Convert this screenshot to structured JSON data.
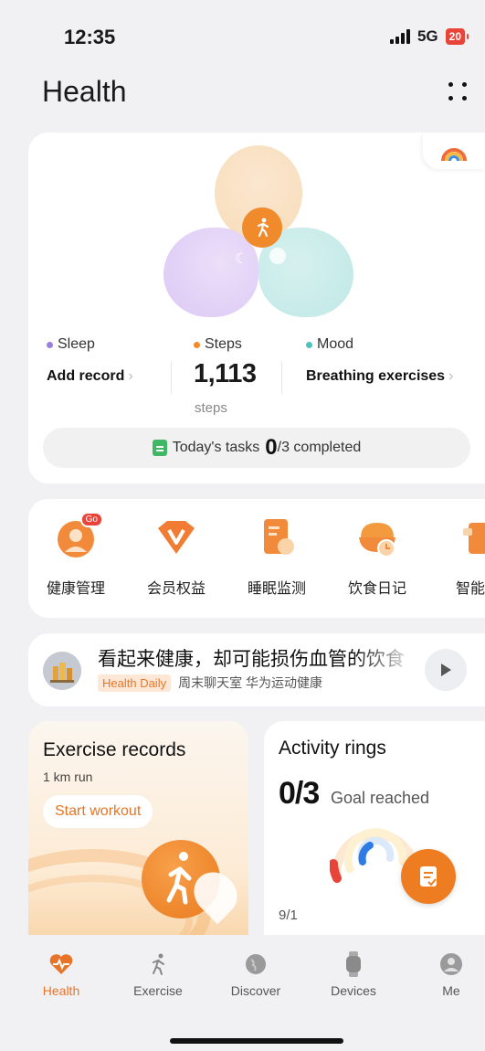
{
  "status_bar": {
    "time": "12:35",
    "network": "5G",
    "battery": "20"
  },
  "header": {
    "title": "Health"
  },
  "summary": {
    "sleep": {
      "label": "Sleep",
      "action": "Add record",
      "color": "#9b7de0"
    },
    "steps": {
      "label": "Steps",
      "value": "1,113",
      "unit": "steps",
      "color": "#f08a2a"
    },
    "mood": {
      "label": "Mood",
      "action": "Breathing exercises",
      "color": "#4cc4bd"
    },
    "tasks": {
      "prefix": "Today's tasks",
      "done": "0",
      "suffix": "/3 completed"
    }
  },
  "services": [
    {
      "label": "健康管理",
      "icon": "health-management-icon",
      "badge": "Go"
    },
    {
      "label": "会员权益",
      "icon": "membership-icon"
    },
    {
      "label": "睡眠监测",
      "icon": "sleep-monitor-icon"
    },
    {
      "label": "饮食日记",
      "icon": "diet-diary-icon"
    },
    {
      "label": "智能冰",
      "icon": "smart-device-icon"
    }
  ],
  "article": {
    "title": "看起来健康，却可能损伤血管的饮食",
    "tag": "Health Daily",
    "source": "周末聊天室 华为运动健康"
  },
  "exercise": {
    "title": "Exercise records",
    "subtitle": "1 km run",
    "button": "Start workout"
  },
  "activity": {
    "title": "Activity rings",
    "count": "0/3",
    "goal": "Goal reached",
    "date": "9/1"
  },
  "nav": [
    {
      "label": "Health",
      "icon": "heart-pulse-icon",
      "active": true
    },
    {
      "label": "Exercise",
      "icon": "runner-icon"
    },
    {
      "label": "Discover",
      "icon": "globe-icon"
    },
    {
      "label": "Devices",
      "icon": "watch-icon"
    },
    {
      "label": "Me",
      "icon": "user-icon"
    }
  ],
  "colors": {
    "accent": "#e8742a",
    "background": "#f1f1f3"
  }
}
